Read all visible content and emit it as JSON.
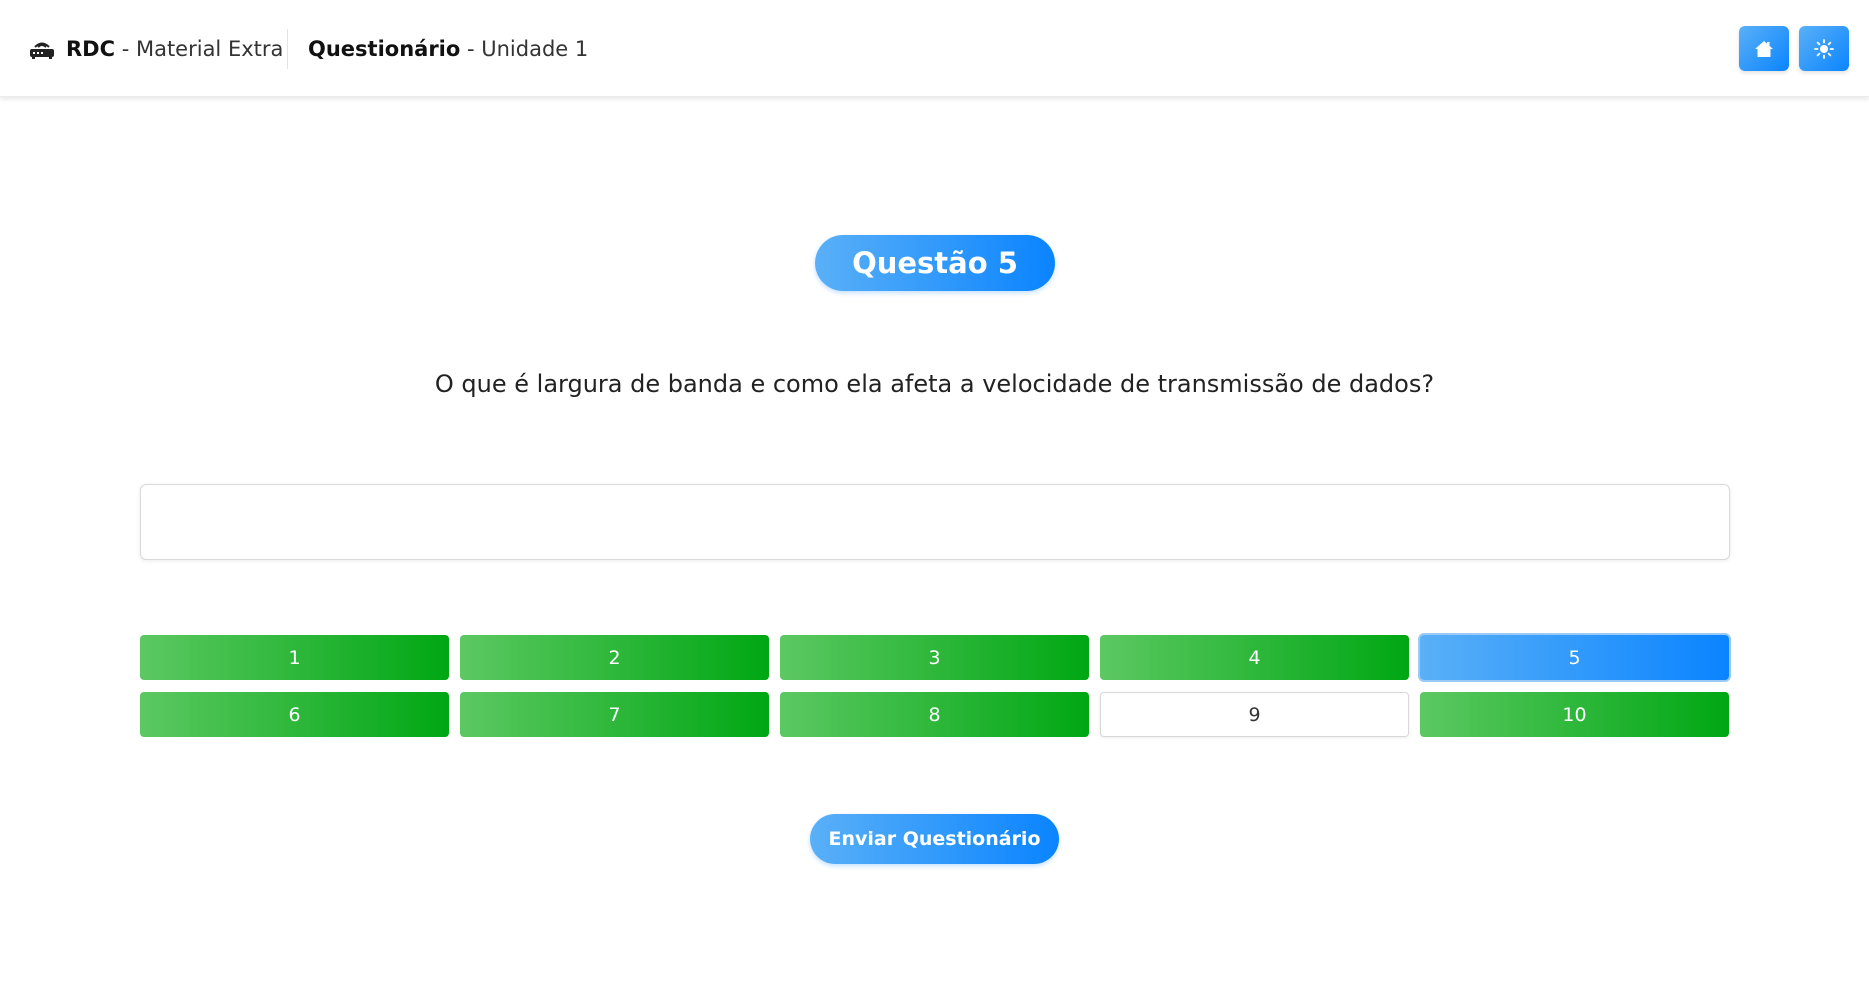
{
  "header": {
    "logo_icon": "router-icon",
    "app_name": "RDC",
    "app_separator": " - ",
    "app_subtitle": "Material Extra",
    "page_title": "Questionário",
    "page_separator": " - ",
    "page_subtitle": "Unidade 1",
    "home_icon": "home-icon",
    "theme_icon": "sun-icon",
    "accent_color": "#0a84ff"
  },
  "quiz": {
    "question_label": "Questão 5",
    "question_text": "O que é largura de banda e como ela afeta a velocidade de transmissão de dados?",
    "answer_value": "",
    "answered_color": "#00a713",
    "current_color": "#0a84ff",
    "nav": [
      {
        "label": "1",
        "state": "answered"
      },
      {
        "label": "2",
        "state": "answered"
      },
      {
        "label": "3",
        "state": "answered"
      },
      {
        "label": "4",
        "state": "answered"
      },
      {
        "label": "5",
        "state": "current"
      },
      {
        "label": "6",
        "state": "answered"
      },
      {
        "label": "7",
        "state": "answered"
      },
      {
        "label": "8",
        "state": "answered"
      },
      {
        "label": "9",
        "state": "empty"
      },
      {
        "label": "10",
        "state": "answered"
      }
    ],
    "submit_label": "Enviar Questionário"
  }
}
